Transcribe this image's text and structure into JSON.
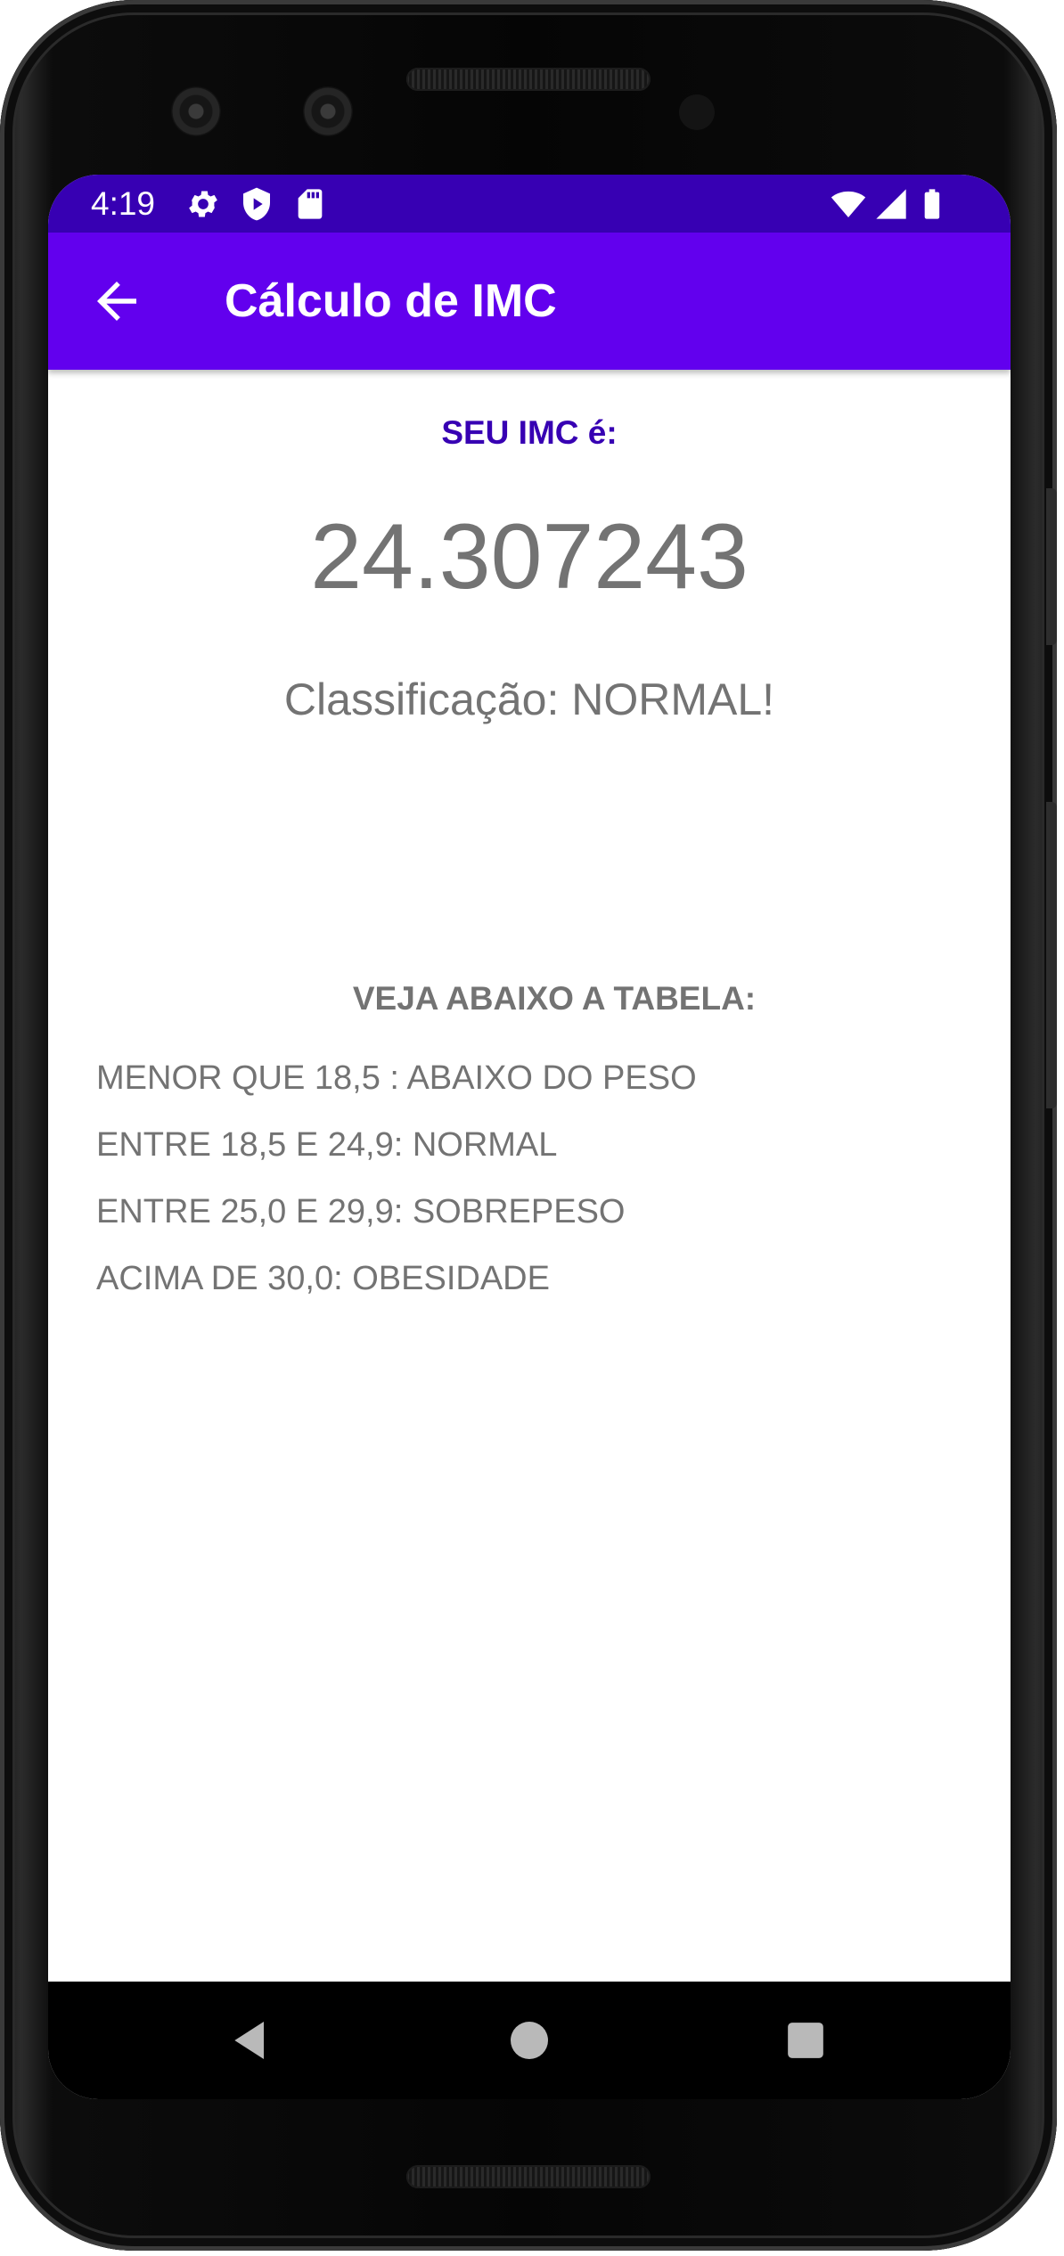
{
  "status_bar": {
    "time": "4:19",
    "icons_left": [
      "gear-icon",
      "play-shield-icon",
      "sd-card-icon"
    ],
    "icons_right": [
      "wifi-icon",
      "signal-icon",
      "battery-icon"
    ]
  },
  "app_bar": {
    "title": "Cálculo de IMC",
    "back_icon": "arrow-back-icon"
  },
  "result": {
    "label": "SEU IMC é:",
    "value": "24.307243",
    "classification": "Classificação: NORMAL!"
  },
  "table": {
    "title": "VEJA ABAIXO A TABELA:",
    "rows": [
      "MENOR QUE 18,5 : ABAIXO DO PESO",
      "ENTRE 18,5 E 24,9: NORMAL",
      "ENTRE 25,0 E 29,9: SOBREPESO",
      "ACIMA DE 30,0: OBESIDADE"
    ]
  },
  "nav_bar": {
    "buttons": [
      "nav-back-icon",
      "nav-home-icon",
      "nav-recents-icon"
    ]
  },
  "colors": {
    "status_bar": "#3700b3",
    "app_bar": "#6200ee",
    "accent_text": "#3700b3",
    "body_text": "#737373"
  }
}
